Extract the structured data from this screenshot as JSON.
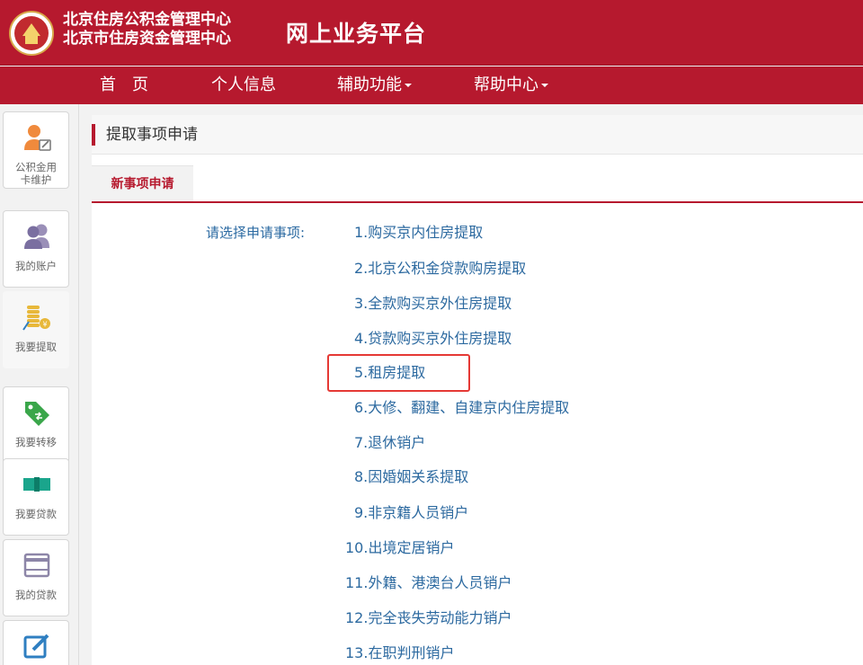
{
  "header": {
    "org_name_line1": "北京住房公积金管理中心",
    "org_name_line2": "北京市住房资金管理中心",
    "platform_title": "网上业务平台"
  },
  "nav": {
    "items": [
      {
        "label": "首　页",
        "dropdown": false
      },
      {
        "label": "个人信息",
        "dropdown": false
      },
      {
        "label": "辅助功能",
        "dropdown": true
      },
      {
        "label": "帮助中心",
        "dropdown": true
      }
    ]
  },
  "sidebar": {
    "items": [
      {
        "label_line1": "公积金用",
        "label_line2": "卡维护",
        "icon": "user-edit-icon"
      },
      {
        "label_line1": "我的账户",
        "label_line2": "",
        "icon": "users-icon"
      },
      {
        "label_line1": "我要提取",
        "label_line2": "",
        "icon": "coins-icon",
        "active": true
      },
      {
        "label_line1": "我要转移",
        "label_line2": "",
        "icon": "tag-transfer-icon"
      },
      {
        "label_line1": "我要贷款",
        "label_line2": "",
        "icon": "money-icon"
      },
      {
        "label_line1": "我的贷款",
        "label_line2": "",
        "icon": "storefront-icon"
      },
      {
        "label_line1": "",
        "label_line2": "",
        "icon": "edit-icon"
      }
    ]
  },
  "page": {
    "title": "提取事项申请",
    "tab_label": "新事项申请",
    "prompt": "请选择申请事项:",
    "options": [
      "1.购买京内住房提取",
      "2.北京公积金贷款购房提取",
      "3.全款购买京外住房提取",
      "4.贷款购买京外住房提取",
      "5.租房提取",
      "6.大修、翻建、自建京内住房提取",
      "7.退休销户",
      "8.因婚姻关系提取",
      "9.非京籍人员销户",
      "10.出境定居销户",
      "11.外籍、港澳台人员销户",
      "12.完全丧失劳动能力销户",
      "13.在职判刑销户"
    ]
  },
  "colors": {
    "brand_red": "#b6192e",
    "link_blue": "#2d6aa0",
    "highlight_red": "#e53935"
  }
}
